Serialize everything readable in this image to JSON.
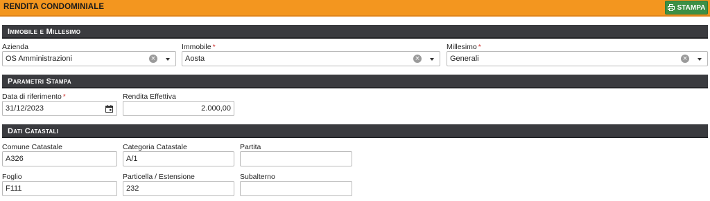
{
  "header": {
    "title": "RENDITA CONDOMINIALE",
    "print_label": "STAMPA"
  },
  "sections": {
    "immobile": "Immobile e Millesimo",
    "parametri": "Parametri Stampa",
    "catastali": "Dati Catastali"
  },
  "immobile_millesimo": {
    "azienda_label": "Azienda",
    "azienda_value": "OS Amministrazioni",
    "immobile_label": "Immobile",
    "immobile_value": "Aosta",
    "millesimo_label": "Millesimo",
    "millesimo_value": "Generali",
    "required_mark": "*"
  },
  "parametri_stampa": {
    "data_label": "Data di riferimento",
    "data_value": "31/12/2023",
    "rendita_label": "Rendita Effettiva",
    "rendita_value": "2.000,00"
  },
  "dati_catastali": {
    "comune_label": "Comune Catastale",
    "comune_value": "A326",
    "categoria_label": "Categoria Catastale",
    "categoria_value": "A/1",
    "partita_label": "Partita",
    "partita_value": "",
    "foglio_label": "Foglio",
    "foglio_value": "F111",
    "particella_label": "Particella / Estensione",
    "particella_value": "232",
    "subalterno_label": "Subalterno",
    "subalterno_value": ""
  },
  "icons": {
    "print": "printer-icon",
    "clear": "clear-icon",
    "dropdown": "chevron-down-icon",
    "calendar": "calendar-icon"
  },
  "colors": {
    "header_bg": "#f3961f",
    "section_bg": "#3a3b3f",
    "print_button_bg": "#3c8f45",
    "required": "#d0312d"
  }
}
